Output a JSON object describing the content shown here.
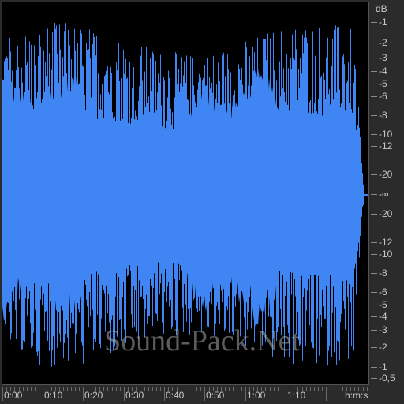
{
  "colors": {
    "waveform": "#3f86f4",
    "background": "#000000",
    "ruler_bg": "#2b2b2b",
    "ruler_text": "#c8c8c8"
  },
  "db_scale": {
    "unit_label": "dB",
    "top_labels": [
      "-1",
      "-2",
      "-3",
      "-4",
      "-5",
      "-6",
      "-8",
      "-10",
      "-12",
      "-20"
    ],
    "center_label": "-∞",
    "bottom_labels": [
      "-20",
      "-12",
      "-10",
      "-8",
      "-6",
      "-5",
      "-4",
      "-3",
      "-2",
      "-1",
      "-0,5"
    ]
  },
  "time_scale": {
    "labels": [
      "0:00",
      "0:10",
      "0:20",
      "0:30",
      "0:40",
      "0:50",
      "1:00",
      "1:10"
    ],
    "unit_label": "h:m:s"
  },
  "watermark": "Sound-Pack.Net"
}
